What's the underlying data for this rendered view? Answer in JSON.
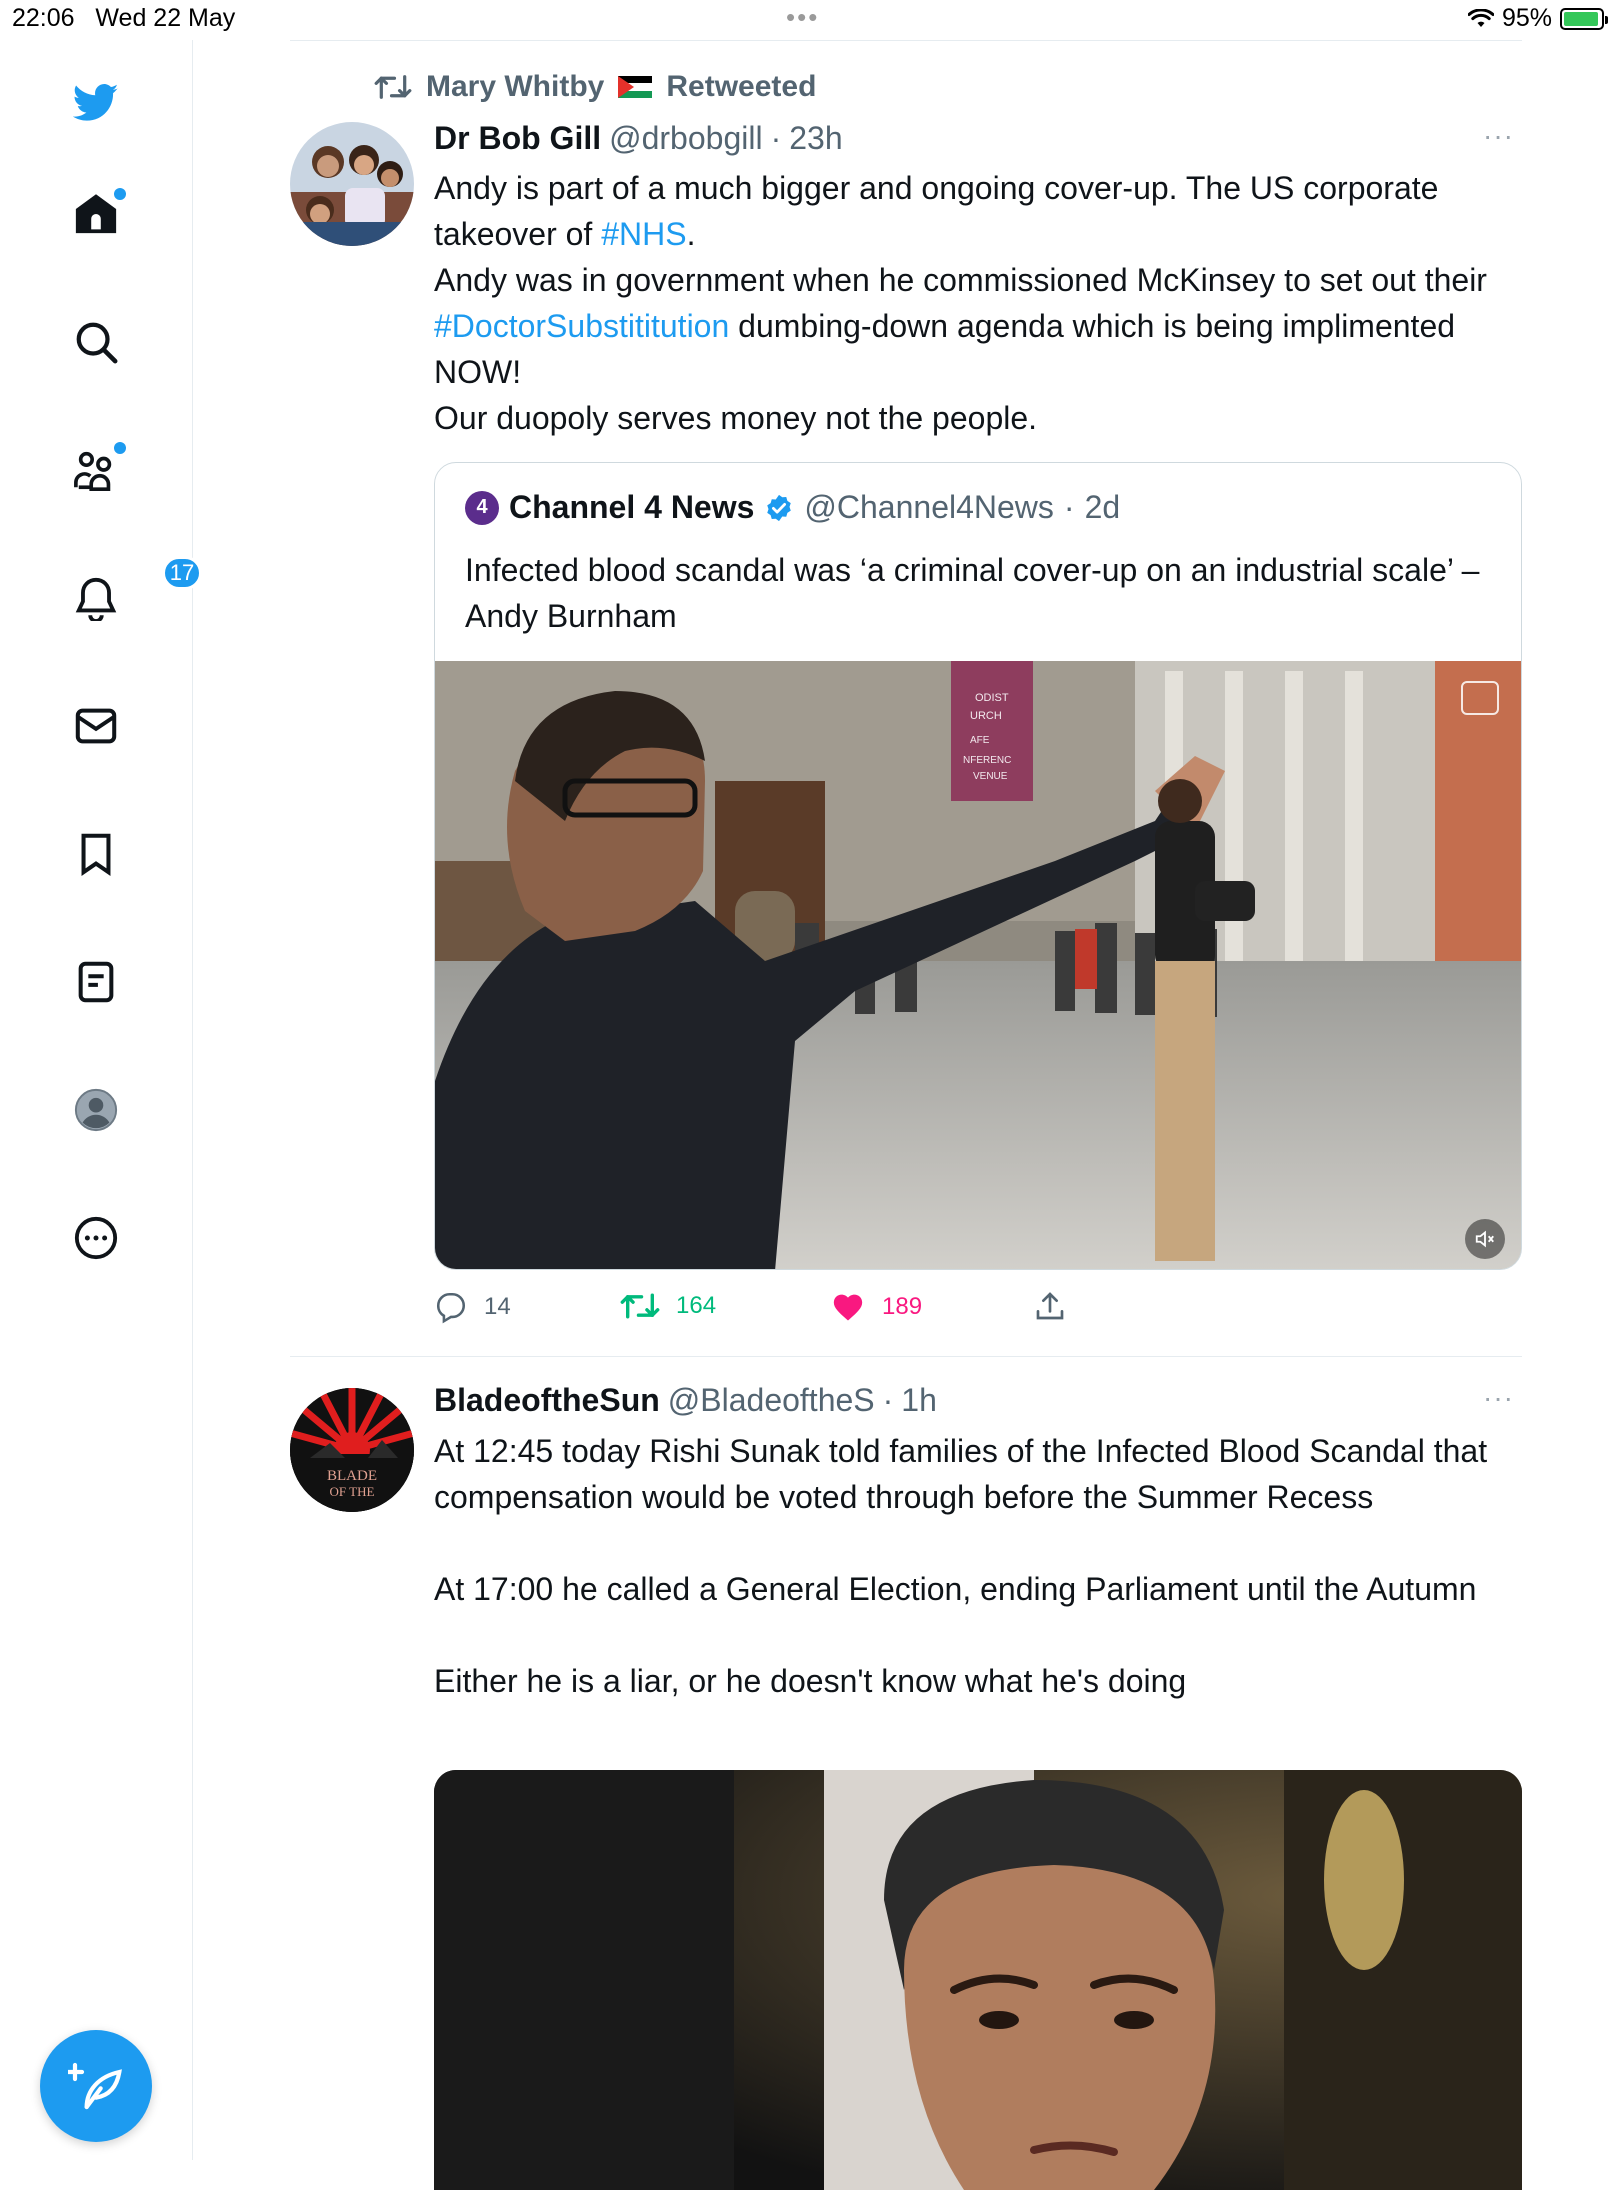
{
  "status_bar": {
    "time": "22:06",
    "date": "Wed 22 May",
    "battery": "95%",
    "battery_level": 0.95
  },
  "sidebar": {
    "notifications_badge": "17",
    "icons": [
      "twitter-bird-icon",
      "home-icon",
      "search-icon",
      "communities-icon",
      "notifications-icon",
      "messages-icon",
      "bookmarks-icon",
      "lists-icon",
      "profile-icon",
      "more-icon"
    ],
    "compose_icon": "compose-tweet-icon"
  },
  "tweets": [
    {
      "retweet_context": {
        "user": "Mary Whitby",
        "label": "Retweeted"
      },
      "name": "Dr Bob Gill",
      "handle": "@drbobgill",
      "time": "23h",
      "more": "···",
      "lines": [
        {
          "pre": "Andy is part of a much bigger and ongoing cover-up. The US corporate takeover of ",
          "link": "#NHS",
          "post": "."
        },
        {
          "pre": "Andy was in government when he commissioned McKinsey to set out their ",
          "link": "#DoctorSubstititution",
          "post": " dumbing-down agenda which is being implimented NOW!"
        },
        {
          "pre": "Our duopoly serves money not the people.",
          "link": "",
          "post": ""
        }
      ],
      "quote": {
        "logo_text": "4",
        "name": "Channel 4 News",
        "handle": "@Channel4News",
        "time": "2d",
        "text": "Infected blood scandal was ‘a criminal cover-up on an industrial scale’ – Andy Burnham",
        "banner_lines": [
          "ODIST",
          "URCH",
          "AFE",
          "NFERENC",
          "VENUE"
        ]
      },
      "actions": {
        "replies": "14",
        "retweets": "164",
        "likes": "189"
      }
    },
    {
      "name": "BladeoftheSun",
      "handle": "@BladeoftheS",
      "time": "1h",
      "more": "···",
      "avatar_text": [
        "BLADE",
        "OF THE"
      ],
      "paragraphs": [
        "At 12:45 today Rishi Sunak told families of the Infected Blood Scandal that compensation would be voted through before the Summer Recess",
        "At 17:00 he called a General Election, ending Parliament until the Autumn",
        "Either he is a liar, or he doesn't know what he's doing"
      ]
    }
  ],
  "colors": {
    "accent": "#1d9bf0",
    "retweet_green": "#00ba7c",
    "like_pink": "#f91880",
    "secondary_text": "#536471",
    "border": "#e6ecf0",
    "channel4_purple": "#5b2d8c"
  }
}
